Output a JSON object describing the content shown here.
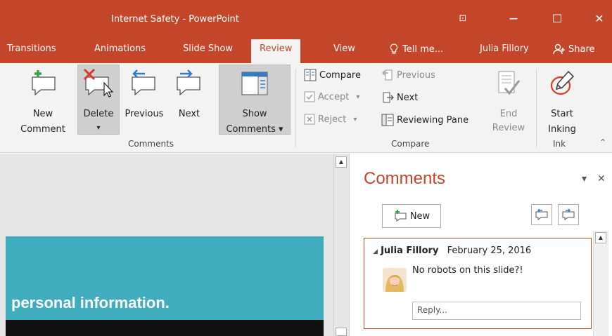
{
  "window": {
    "title": "Internet Safety - PowerPoint",
    "restore_glyph": "⊡",
    "minimize_glyph": "—",
    "maximize_glyph": "☐",
    "close_glyph": "✕"
  },
  "tabs": [
    {
      "label": "Transitions"
    },
    {
      "label": "Animations"
    },
    {
      "label": "Slide Show"
    },
    {
      "label": "Review",
      "active": true
    },
    {
      "label": "View"
    },
    {
      "label": "Tell me..."
    }
  ],
  "account": {
    "user": "Julia Fillory",
    "share_label": "Share"
  },
  "ribbon": {
    "comments_group": {
      "new_line1": "New",
      "new_line2": "Comment",
      "delete_label": "Delete",
      "delete_arrow": "▾",
      "previous_label": "Previous",
      "next_label": "Next",
      "show_line1": "Show",
      "show_line2": "Comments ▾",
      "label": "Comments"
    },
    "compare_group": {
      "compare": "Compare",
      "accept": "Accept",
      "accept_arrow": "▾",
      "reject": "Reject",
      "reject_arrow": "▾",
      "previous": "Previous",
      "next": "Next",
      "reviewing_pane": "Reviewing Pane",
      "end_line1": "End",
      "end_line2": "Review",
      "label": "Compare"
    },
    "ink_group": {
      "start_line1": "Start",
      "start_line2": "Inking",
      "label": "Ink"
    },
    "collapse_glyph": "⌃"
  },
  "slide": {
    "visible_text": "personal information."
  },
  "comments_pane": {
    "title": "Comments",
    "new_button": "New",
    "menu_glyph": "▾",
    "close_glyph": "✕",
    "comment": {
      "author": "Julia Fillory",
      "date": "February 25, 2016",
      "text": "No robots on this slide?!",
      "reply_placeholder": "Reply..."
    }
  },
  "colors": {
    "accent": "#c4462a",
    "slide_teal": "#3fadbe"
  }
}
